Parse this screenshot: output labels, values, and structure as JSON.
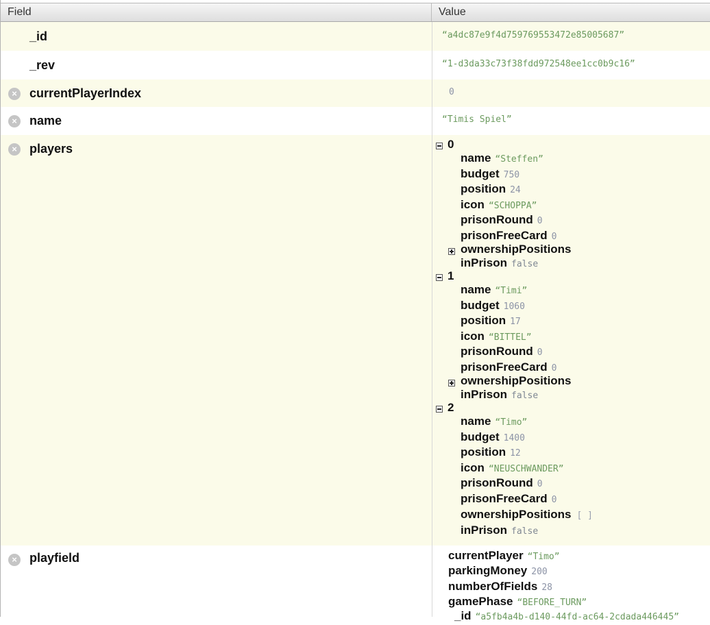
{
  "header": {
    "field_label": "Field",
    "value_label": "Value"
  },
  "rows": {
    "id": {
      "field": "_id",
      "value": "“a4dc87e9f4d759769553472e85005687”"
    },
    "rev": {
      "field": "_rev",
      "value": "“1-d3da33c73f38fdd972548ee1cc0b9c16”"
    },
    "currentPlayerIndex": {
      "field": "currentPlayerIndex",
      "value": "0"
    },
    "name": {
      "field": "name",
      "value": "“Timis Spiel”"
    },
    "players": {
      "field": "players"
    },
    "playfield": {
      "field": "playfield"
    }
  },
  "players": [
    {
      "index": "0",
      "name_key": "name",
      "name": "“Steffen”",
      "budget_key": "budget",
      "budget": "750",
      "position_key": "position",
      "position": "24",
      "icon_key": "icon",
      "icon": "“SCHOPPA”",
      "prisonRound_key": "prisonRound",
      "prisonRound": "0",
      "prisonFreeCard_key": "prisonFreeCard",
      "prisonFreeCard": "0",
      "ownership_key": "ownershipPositions",
      "ownership": "",
      "inPrison_key": "inPrison",
      "inPrison": "false"
    },
    {
      "index": "1",
      "name_key": "name",
      "name": "“Timi”",
      "budget_key": "budget",
      "budget": "1060",
      "position_key": "position",
      "position": "17",
      "icon_key": "icon",
      "icon": "“BITTEL”",
      "prisonRound_key": "prisonRound",
      "prisonRound": "0",
      "prisonFreeCard_key": "prisonFreeCard",
      "prisonFreeCard": "0",
      "ownership_key": "ownershipPositions",
      "ownership": "",
      "inPrison_key": "inPrison",
      "inPrison": "false"
    },
    {
      "index": "2",
      "name_key": "name",
      "name": "“Timo”",
      "budget_key": "budget",
      "budget": "1400",
      "position_key": "position",
      "position": "12",
      "icon_key": "icon",
      "icon": "“NEUSCHWANDER”",
      "prisonRound_key": "prisonRound",
      "prisonRound": "0",
      "prisonFreeCard_key": "prisonFreeCard",
      "prisonFreeCard": "0",
      "ownership_key": "ownershipPositions",
      "ownership": "[ ]",
      "inPrison_key": "inPrison",
      "inPrison": "false"
    }
  ],
  "playfield": {
    "currentPlayer_key": "currentPlayer",
    "currentPlayer": "“Timo”",
    "parkingMoney_key": "parkingMoney",
    "parkingMoney": "200",
    "numberOfFields_key": "numberOfFields",
    "numberOfFields": "28",
    "gamePhase_key": "gamePhase",
    "gamePhase": "“BEFORE_TURN”",
    "id_key": "_id",
    "id": "“a5fb4a4b-d140-44fd-ac64-2cdada446445”"
  },
  "icons": {
    "delete": "close-circle-icon",
    "collapse": "minus-box-icon",
    "expand": "plus-box-icon"
  },
  "colors": {
    "odd_row": "#fbfbe9",
    "string_value": "#6b9a5e",
    "number_value": "#8c93a6"
  }
}
